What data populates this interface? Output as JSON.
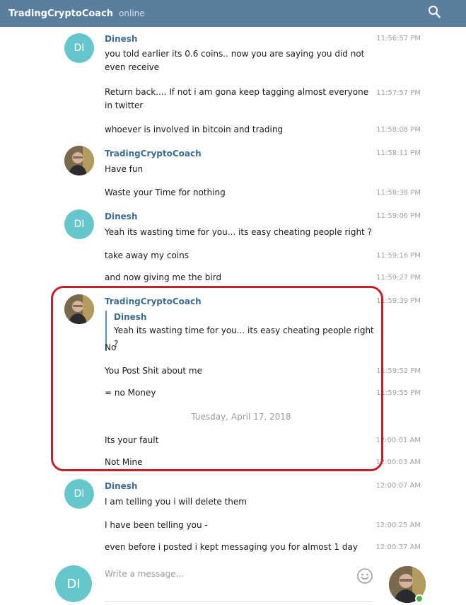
{
  "header": {
    "title": "TradingCryptoCoach",
    "status": "online"
  },
  "messages": [
    {
      "sender": "Dinesh",
      "text": "you told earlier its 0.6 coins.. now you are saying you did not even receive",
      "time": "11:56:57 PM"
    },
    {
      "text": "Return back.... If not i am gona keep tagging almost everyone in twitter",
      "time": "11:57:57 PM"
    },
    {
      "text": "whoever is involved in bitcoin and trading",
      "time": "11:58:08 PM"
    },
    {
      "sender": "TradingCryptoCoach",
      "text": "Have fun",
      "time": "11:58:11 PM"
    },
    {
      "text": "Waste your Time for nothing",
      "time": "11:58:38 PM"
    },
    {
      "sender": "Dinesh",
      "text": "Yeah its wasting time for you... its easy cheating people right ?",
      "time": "11:59:06 PM"
    },
    {
      "text": "take away my coins",
      "time": "11:59:16 PM"
    },
    {
      "text": "and now giving me the bird",
      "time": "11:59:27 PM"
    },
    {
      "sender": "TradingCryptoCoach",
      "reply_name": "Dinesh",
      "reply_text": "Yeah its wasting time for you... its easy cheating people right ?",
      "text": "No",
      "time": "11:59:39 PM"
    },
    {
      "text": "You Post Shit about me",
      "time": "11:59:52 PM"
    },
    {
      "text": "= no Money",
      "time": "11:59:55 PM"
    },
    {
      "date": "Tuesday, April 17, 2018"
    },
    {
      "text": "Its your fault",
      "time": "12:00:01 AM"
    },
    {
      "text": "Not Mine",
      "time": "12:00:03 AM"
    },
    {
      "sender": "Dinesh",
      "text": "I am telling you i will delete them",
      "time": "12:00:07 AM"
    },
    {
      "text": "I have been telling you -",
      "time": "12:00:25 AM"
    },
    {
      "text": "even before i posted i kept messaging you for almost 1 day",
      "time": "12:00:37 AM"
    }
  ],
  "avatars": {
    "dinesh_initials": "DI"
  },
  "composer": {
    "placeholder": "Write a message...",
    "avatar_initials": "DI"
  },
  "colors": {
    "header": "#5a7e9e",
    "sender_name": "#3d6d8f",
    "avatar": "#65c7cc",
    "highlight": "#c3202b",
    "online": "#4cb04c"
  }
}
